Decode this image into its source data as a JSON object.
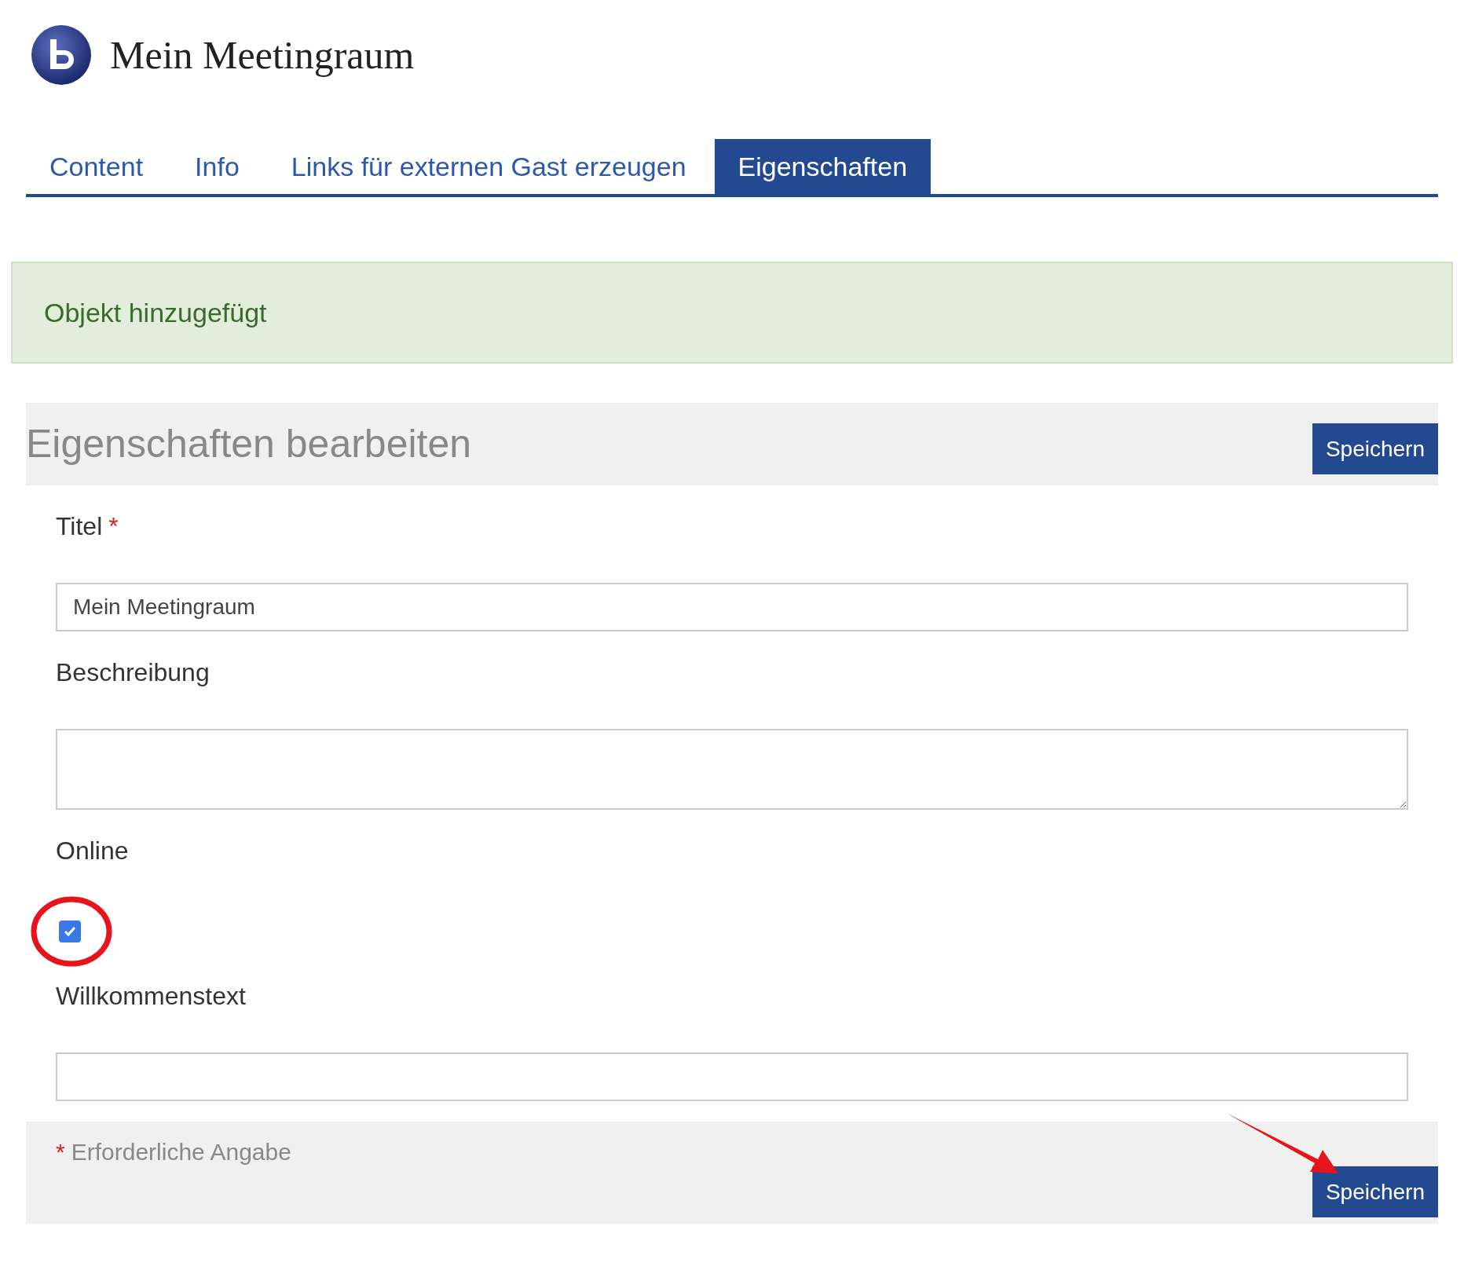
{
  "header": {
    "title": "Mein Meetingraum"
  },
  "tabs": [
    {
      "label": "Content",
      "selected": false
    },
    {
      "label": "Info",
      "selected": false
    },
    {
      "label": "Links für externen Gast erzeugen",
      "selected": false
    },
    {
      "label": "Eigenschaften",
      "selected": true
    }
  ],
  "alert": {
    "message": "Objekt hinzugefügt"
  },
  "form": {
    "heading": "Eigenschaften bearbeiten",
    "save_button": "Speichern",
    "fields": [
      {
        "kind": "text",
        "label": "Titel",
        "required": true,
        "value": "Mein Meetingraum"
      },
      {
        "kind": "textarea",
        "label": "Beschreibung",
        "required": false
      },
      {
        "kind": "checkbox",
        "label": "Online",
        "required": false,
        "checked": true
      },
      {
        "kind": "text",
        "label": "Willkommenstext",
        "required": false
      }
    ],
    "footer": {
      "required_mark": "*",
      "required_note": "Erforderliche Angabe",
      "save_button": "Speichern"
    }
  }
}
